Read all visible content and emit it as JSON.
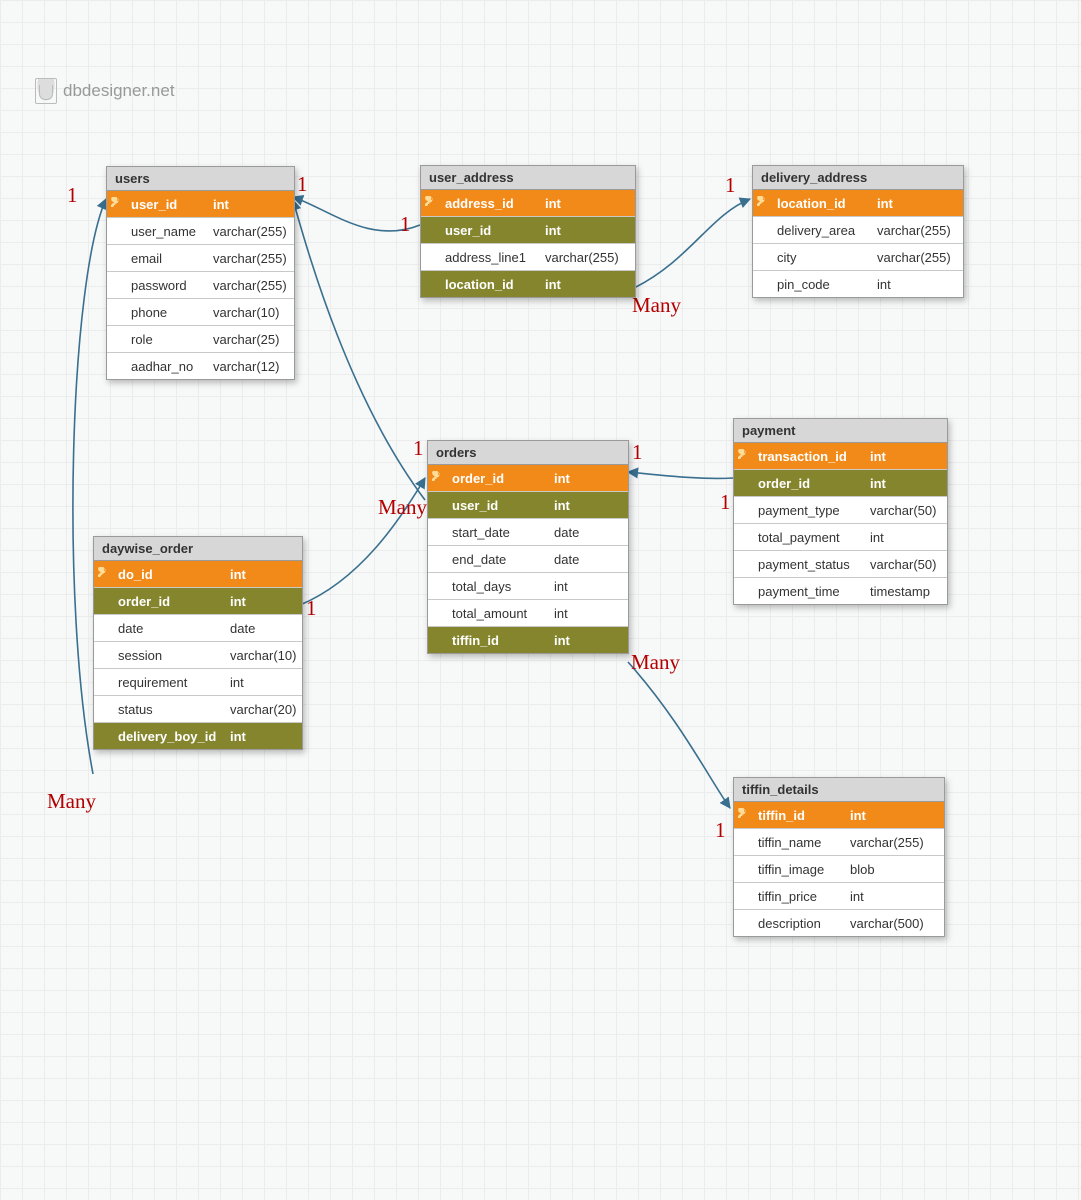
{
  "brand": "dbdesigner.net",
  "labels": {
    "one": "1",
    "many": "Many"
  },
  "tables": {
    "users": {
      "title": "users",
      "cols": [
        {
          "name": "user_id",
          "type": "int",
          "pk": true
        },
        {
          "name": "user_name",
          "type": "varchar(255)"
        },
        {
          "name": "email",
          "type": "varchar(255)"
        },
        {
          "name": "password",
          "type": "varchar(255)"
        },
        {
          "name": "phone",
          "type": "varchar(10)"
        },
        {
          "name": "role",
          "type": "varchar(25)"
        },
        {
          "name": "aadhar_no",
          "type": "varchar(12)"
        }
      ]
    },
    "user_address": {
      "title": "user_address",
      "cols": [
        {
          "name": "address_id",
          "type": "int",
          "pk": true
        },
        {
          "name": "user_id",
          "type": "int",
          "fk": true
        },
        {
          "name": "address_line1",
          "type": "varchar(255)"
        },
        {
          "name": "location_id",
          "type": "int",
          "fk": true
        }
      ]
    },
    "delivery_address": {
      "title": "delivery_address",
      "cols": [
        {
          "name": "location_id",
          "type": "int",
          "pk": true
        },
        {
          "name": "delivery_area",
          "type": "varchar(255)"
        },
        {
          "name": "city",
          "type": "varchar(255)"
        },
        {
          "name": "pin_code",
          "type": "int"
        }
      ]
    },
    "orders": {
      "title": "orders",
      "cols": [
        {
          "name": "order_id",
          "type": "int",
          "pk": true
        },
        {
          "name": "user_id",
          "type": "int",
          "fk": true
        },
        {
          "name": "start_date",
          "type": "date"
        },
        {
          "name": "end_date",
          "type": "date"
        },
        {
          "name": "total_days",
          "type": "int"
        },
        {
          "name": "total_amount",
          "type": "int"
        },
        {
          "name": "tiffin_id",
          "type": "int",
          "fk": true
        }
      ]
    },
    "payment": {
      "title": "payment",
      "cols": [
        {
          "name": "transaction_id",
          "type": "int",
          "pk": true
        },
        {
          "name": "order_id",
          "type": "int",
          "fk": true
        },
        {
          "name": "payment_type",
          "type": "varchar(50)"
        },
        {
          "name": "total_payment",
          "type": "int"
        },
        {
          "name": "payment_status",
          "type": "varchar(50)"
        },
        {
          "name": "payment_time",
          "type": "timestamp"
        }
      ]
    },
    "daywise_order": {
      "title": "daywise_order",
      "cols": [
        {
          "name": "do_id",
          "type": "int",
          "pk": true
        },
        {
          "name": "order_id",
          "type": "int",
          "fk": true
        },
        {
          "name": "date",
          "type": "date"
        },
        {
          "name": "session",
          "type": "varchar(10)"
        },
        {
          "name": "requirement",
          "type": "int"
        },
        {
          "name": "status",
          "type": "varchar(20)"
        },
        {
          "name": "delivery_boy_id",
          "type": "int",
          "fk": true
        }
      ]
    },
    "tiffin_details": {
      "title": "tiffin_details",
      "cols": [
        {
          "name": "tiffin_id",
          "type": "int",
          "pk": true
        },
        {
          "name": "tiffin_name",
          "type": "varchar(255)"
        },
        {
          "name": "tiffin_image",
          "type": "blob"
        },
        {
          "name": "tiffin_price",
          "type": "int"
        },
        {
          "name": "description",
          "type": "varchar(500)"
        }
      ]
    }
  }
}
